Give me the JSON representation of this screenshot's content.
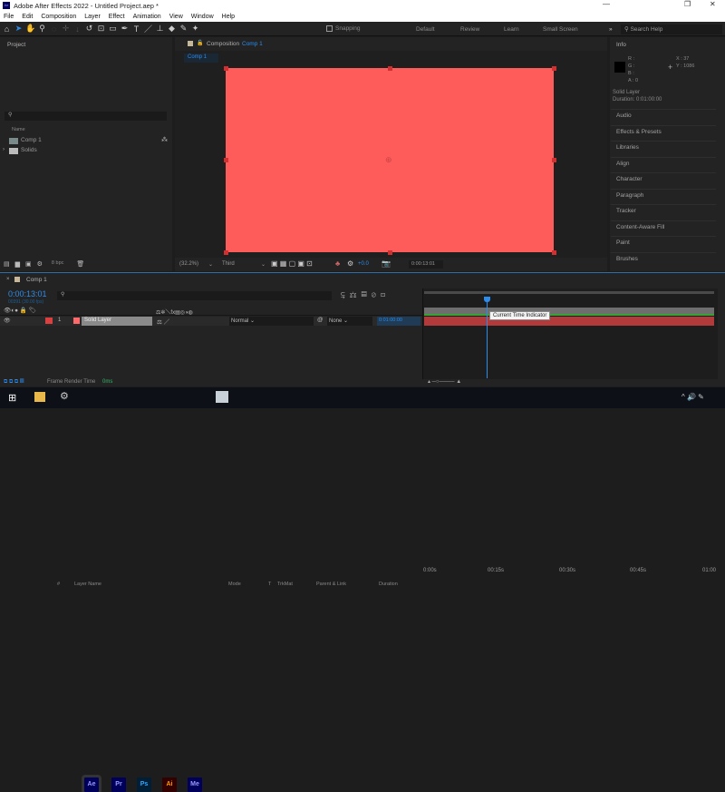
{
  "window": {
    "title": "Adobe After Effects 2022 - Untitled Project.aep *",
    "app_icon": "Ae",
    "controls": [
      "—",
      "❐",
      "✕"
    ]
  },
  "menu": [
    "File",
    "Edit",
    "Composition",
    "Layer",
    "Effect",
    "Animation",
    "View",
    "Window",
    "Help"
  ],
  "toolbar": {
    "snapping": "Snapping",
    "workspaces": [
      "Default",
      "Review",
      "Learn",
      "Small Screen"
    ],
    "more": "»",
    "search_placeholder": "Search Help"
  },
  "project": {
    "title": "Project",
    "column_name": "Name",
    "items": [
      {
        "name": "Comp 1",
        "type": "composition"
      },
      {
        "name": "Solids",
        "type": "folder"
      }
    ],
    "bpc": "8 bpc"
  },
  "composition": {
    "title": "Composition",
    "comp_name": "Comp 1",
    "tab": "Comp 1",
    "zoom": "(32.2%)",
    "resolution": "Third",
    "exposure": "+0.0",
    "timecode": "0:00:13:01",
    "solid_color": "#fe5b5b"
  },
  "info": {
    "title": "Info",
    "r": "R :",
    "g": "G :",
    "b": "B :",
    "a": "A : 0",
    "x": "X : 37",
    "y": "Y : 1086",
    "layer": "Solid Layer",
    "duration": "Duration: 0:01:00:00"
  },
  "right_panels": [
    "Audio",
    "Effects & Presets",
    "Libraries",
    "Align",
    "Character",
    "Paragraph",
    "Tracker",
    "Content-Aware Fill",
    "Paint",
    "Brushes"
  ],
  "timeline": {
    "tab": "Comp 1",
    "current_time": "0:00:13:01",
    "frame_info": "00391 (30.00 fps)",
    "columns": {
      "num": "#",
      "layer_name": "Layer Name",
      "mode": "Mode",
      "t": "T",
      "trkmat": "TrkMat",
      "parent": "Parent & Link",
      "duration": "Duration"
    },
    "layers": [
      {
        "index": "1",
        "name": "Solid Layer",
        "mode": "Normal",
        "parent": "None",
        "duration": "0:01:00:00",
        "color": "#d9403f"
      }
    ],
    "ruler": [
      "0:00s",
      "00:15s",
      "00:30s",
      "00:45s",
      "01:00"
    ],
    "current_time_fraction": 0.217,
    "tooltip": "Current Time Indicator",
    "render_label": "Frame Render Time",
    "render_value": "0ms"
  },
  "taskbar": {
    "apps": [
      "Ae",
      "Pr",
      "Ps",
      "Ai",
      "Me"
    ]
  }
}
